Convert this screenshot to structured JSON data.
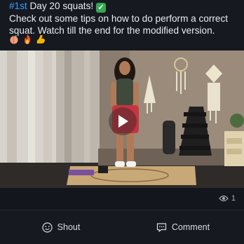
{
  "post": {
    "hashtag": "#1st",
    "headline": " Day 20 squats! ",
    "body": "Check out some tips on how to do perform a correct squat. Watch till the end for the modified version.",
    "emojis": [
      "peach-emoji",
      "fire-emoji",
      "flexed-biceps-emoji"
    ]
  },
  "video": {
    "play_icon": "play-icon"
  },
  "stats": {
    "view_count": "1",
    "view_icon": "eye-icon"
  },
  "actions": {
    "shout_label": "Shout",
    "shout_icon": "smiley-icon",
    "comment_label": "Comment",
    "comment_icon": "comment-icon"
  },
  "colors": {
    "hashtag": "#3b9cff",
    "check": "#35a852",
    "background": "#161a20"
  }
}
